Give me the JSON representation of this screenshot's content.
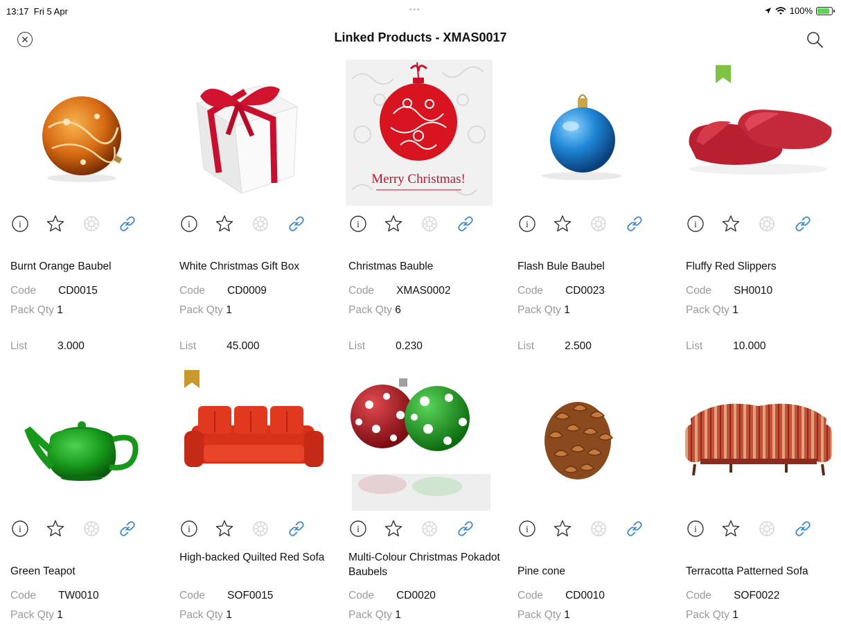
{
  "status": {
    "time": "13:17",
    "date": "Fri 5 Apr",
    "dots": "•••",
    "battery": "100%"
  },
  "header": {
    "title": "Linked Products - XMAS0017"
  },
  "labels": {
    "code": "Code",
    "pack_qty": "Pack Qty",
    "list": "List"
  },
  "icons": {
    "close": "close-icon",
    "search": "search-icon",
    "info": "info-icon",
    "favourite": "star-icon",
    "disabled": "disabled-icon",
    "link": "link-icon"
  },
  "colors": {
    "link_icon": "#3a87d0",
    "bookmark_green": "#7dc242",
    "bookmark_gold": "#c89a2e"
  },
  "products": [
    {
      "name": "Burnt Orange Baubel",
      "code": "CD0015",
      "pack_qty": "1",
      "list": "3.000",
      "image": "orange-bauble",
      "bookmark": ""
    },
    {
      "name": "White Christmas Gift Box",
      "code": "CD0009",
      "pack_qty": "1",
      "list": "45.000",
      "image": "gift-box",
      "bookmark": ""
    },
    {
      "name": "Christmas Bauble",
      "code": "XMAS0002",
      "pack_qty": "6",
      "list": "0.230",
      "image": "merry-christmas-card",
      "image_text": "Merry Christmas!",
      "bookmark": ""
    },
    {
      "name": "Flash Bule Baubel",
      "code": "CD0023",
      "pack_qty": "1",
      "list": "2.500",
      "image": "blue-bauble",
      "bookmark": ""
    },
    {
      "name": "Fluffy Red Slippers",
      "code": "SH0010",
      "pack_qty": "1",
      "list": "10.000",
      "image": "red-slippers",
      "bookmark": "green"
    },
    {
      "name": "Green Teapot",
      "code": "TW0010",
      "pack_qty": "1",
      "image": "green-teapot",
      "bookmark": ""
    },
    {
      "name": "High-backed Quilted Red Sofa",
      "code": "SOF0015",
      "pack_qty": "1",
      "image": "red-sofa",
      "bookmark": "gold"
    },
    {
      "name": "Multi-Colour Christmas Pokadot Baubels",
      "code": "CD0020",
      "pack_qty": "1",
      "image": "polka-dot-baubles",
      "bookmark": ""
    },
    {
      "name": "Pine cone",
      "code": "CD0010",
      "pack_qty": "1",
      "image": "pine-cone",
      "bookmark": ""
    },
    {
      "name": "Terracotta Patterned Sofa",
      "code": "SOF0022",
      "pack_qty": "1",
      "image": "striped-sofa",
      "bookmark": ""
    }
  ]
}
